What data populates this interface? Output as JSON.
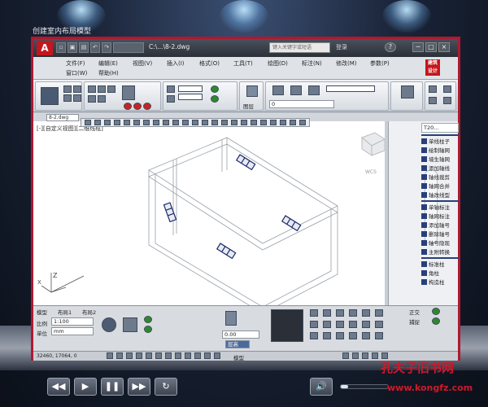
{
  "movie": {
    "title": "创建室内布局模型"
  },
  "autocad": {
    "logo": "A",
    "filename": "C:\\...\\8-2.dwg",
    "search_placeholder": "键入关键字或短语",
    "login": "登录",
    "help": "?",
    "window_controls": [
      "─",
      "□",
      "×"
    ],
    "menus_row1": [
      "文件(F)",
      "编辑(E)",
      "视图(V)",
      "插入(I)",
      "格式(O)",
      "工具(T)",
      "绘图(D)",
      "标注(N)",
      "修改(M)",
      "参数(P)"
    ],
    "menus_row2": [
      "窗口(W)",
      "帮助(H)"
    ],
    "badge": "建筑 设计",
    "doc_tab": "8-2.dwg",
    "view_label": "[-][自定义视图][二维线框]",
    "viewcube_label": "WCS",
    "layer_value": "0",
    "layer_btn": "图层",
    "palette": {
      "header": "T20...",
      "items": [
        "单线柱子",
        "绘制轴网",
        "墙生轴网",
        "添加轴线",
        "轴线裁剪",
        "轴网合并",
        "轴改线型",
        "单轴标注",
        "轴网标注",
        "添加轴号",
        "删除轴号",
        "轴号隐现",
        "主附转换",
        "标准柱",
        "角柱",
        "构造柱"
      ]
    },
    "cmd": {
      "tabs": [
        "模型",
        "布局1",
        "布局2"
      ],
      "scale_label": "比例",
      "scale_value": "1:100",
      "unit_label": "单位",
      "unit_value": "mm",
      "value_field": "0.00",
      "equals_btn": "层高",
      "snap_labels": [
        "正交",
        "捕捉"
      ]
    },
    "status": {
      "coords": "32460, 17064, 0",
      "model_label": "模型"
    }
  },
  "player": {
    "buttons": [
      "◀◀",
      "▶",
      "❚❚",
      "▶▶",
      "↻"
    ],
    "volume_icon": "🔊",
    "volume_level": 0.15
  },
  "watermark": {
    "line1": "孔夫子旧书网",
    "line2": "www.kongfz.com"
  },
  "colors": {
    "frame_border": "#b01830",
    "palette_accent": "#2a3f7a",
    "watermark": "#d0182a"
  }
}
